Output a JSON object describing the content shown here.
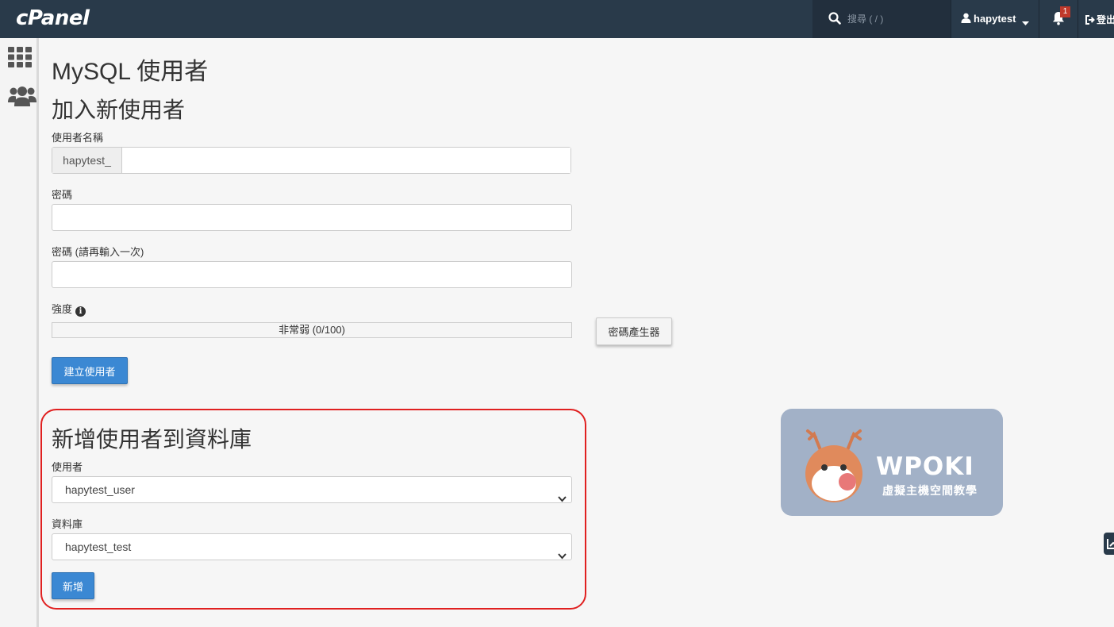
{
  "brand": {
    "logo_text": "cPanel"
  },
  "header": {
    "search_placeholder": "搜尋 ( / )",
    "username": "hapytest",
    "notification_count": "1",
    "logout_label": "登出"
  },
  "sidebar": {
    "items": [
      "apps-grid-icon",
      "users-icon"
    ]
  },
  "page": {
    "title": "MySQL 使用者"
  },
  "add_user": {
    "title": "加入新使用者",
    "username_label": "使用者名稱",
    "username_prefix": "hapytest_",
    "username_value": "",
    "password_label": "密碼",
    "password_value": "",
    "password_again_label": "密碼 (請再輸入一次)",
    "password_again_value": "",
    "strength_label": "強度",
    "strength_text": "非常弱 (0/100)",
    "strength_value": 0,
    "generator_button": "密碼產生器",
    "create_button": "建立使用者"
  },
  "add_user_to_db": {
    "title": "新增使用者到資料庫",
    "user_label": "使用者",
    "user_selected": "hapytest_user",
    "db_label": "資料庫",
    "db_selected": "hapytest_test",
    "add_button": "新增"
  },
  "watermark": {
    "name": "WPOKI",
    "tagline": "虛擬主機空間教學"
  },
  "colors": {
    "topbar": "#293a4a",
    "primary_button": "#3b88d3",
    "highlight_border": "#e02020",
    "watermark_bg": "#a2b1c7"
  }
}
